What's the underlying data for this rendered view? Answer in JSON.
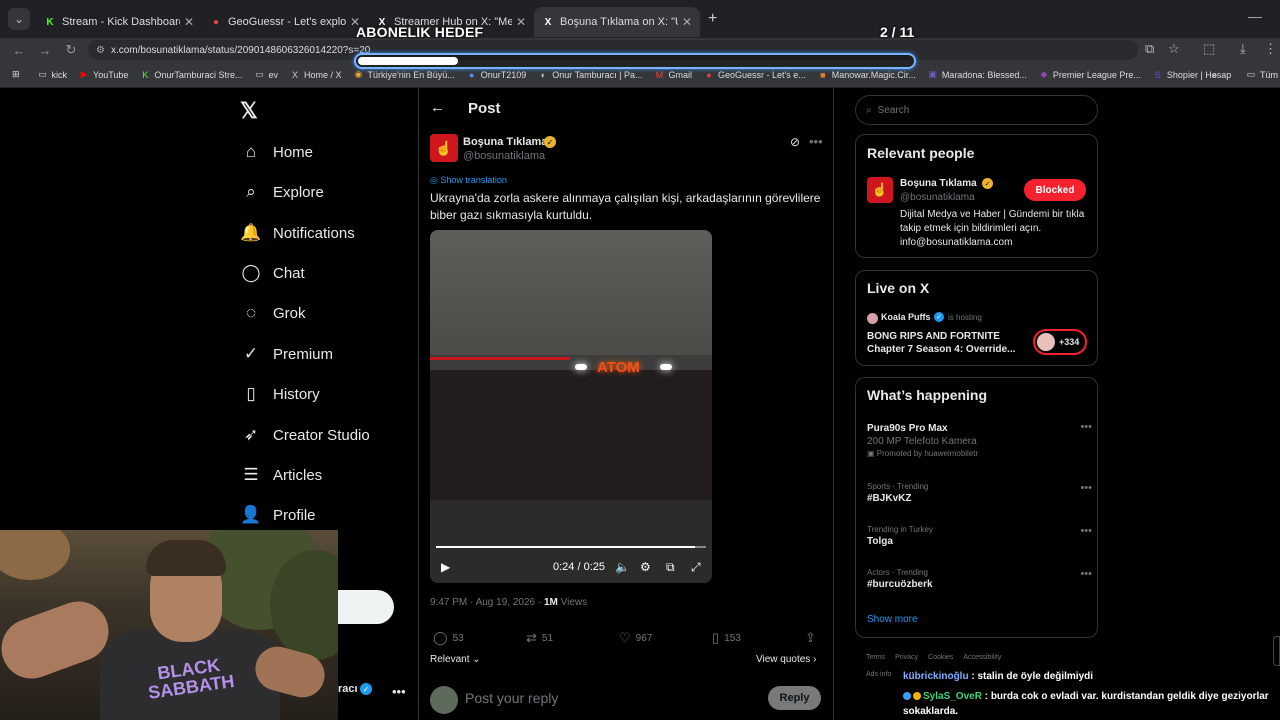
{
  "browser": {
    "tabs": [
      {
        "title": "Stream - Kick Dashboard",
        "fav": "K",
        "fav_color": "#53fc18"
      },
      {
        "title": "GeoGuessr - Let's explore the w",
        "fav": "●",
        "fav_color": "#e64141"
      },
      {
        "title": "Streamer Hub on X: \"Mercan E",
        "fav": "X",
        "fav_color": "#ffffff"
      },
      {
        "title": "Boşuna Tıklama on X: \"Ukrayna",
        "fav": "X",
        "fav_color": "#ffffff"
      }
    ],
    "url": "x.com/bosunatiklama/status/2090148606326014220?s=20",
    "bookmarks": [
      {
        "label": "kick",
        "icon": "folder-icon"
      },
      {
        "label": "YouTube",
        "icon": "youtube-icon"
      },
      {
        "label": "OnurTamburaci Stre...",
        "icon": "kick-icon"
      },
      {
        "label": "ev",
        "icon": "folder-icon"
      },
      {
        "label": "Home / X",
        "icon": "x-icon"
      },
      {
        "label": "Türkiye'nin En Büyü...",
        "icon": "globe-icon"
      },
      {
        "label": "OnurT2109",
        "icon": "person-icon"
      },
      {
        "label": "Onur Tamburacı | Pa...",
        "icon": "circle-icon"
      },
      {
        "label": "Gmail",
        "icon": "gmail-icon"
      },
      {
        "label": "GeoGuessr - Let's e...",
        "icon": "pin-icon"
      },
      {
        "label": "Manowar.Magic.Cir...",
        "icon": "box-icon"
      },
      {
        "label": "Maradona: Blessed...",
        "icon": "film-icon"
      },
      {
        "label": "Premier League Pre...",
        "icon": "ball-icon"
      },
      {
        "label": "Shopier | Hesap",
        "icon": "shop-icon"
      }
    ],
    "bookmarks_folder": "Tüm"
  },
  "overlay": {
    "goal_title": "ABONELIK HEDEF",
    "goal_count": "2 / 11",
    "goal_progress": 0.18
  },
  "sidebar": {
    "items": [
      {
        "label": "Home",
        "icon": "home-icon",
        "glyph": "⌂"
      },
      {
        "label": "Explore",
        "icon": "search-icon",
        "glyph": "⌕"
      },
      {
        "label": "Notifications",
        "icon": "bell-icon",
        "glyph": "🔔"
      },
      {
        "label": "Chat",
        "icon": "chat-icon",
        "glyph": "◯"
      },
      {
        "label": "Grok",
        "icon": "grok-icon",
        "glyph": "◌"
      },
      {
        "label": "Premium",
        "icon": "premium-icon",
        "glyph": "✓"
      },
      {
        "label": "History",
        "icon": "bookmark-icon",
        "glyph": "▯"
      },
      {
        "label": "Creator Studio",
        "icon": "rocket-icon",
        "glyph": "➶"
      },
      {
        "label": "Articles",
        "icon": "articles-icon",
        "glyph": "☰"
      },
      {
        "label": "Profile",
        "icon": "profile-icon",
        "glyph": "👤"
      }
    ],
    "account_partial": "racı"
  },
  "post": {
    "header_title": "Post",
    "author_name": "Boşuna Tıklama",
    "author_handle": "@bosunatiklama",
    "show_translation": "Show translation",
    "text": "Ukrayna'da zorla askere alınmaya çalışılan kişi, arkadaşlarının görevlilere biber gazı sıkmasıyla kurtuldu.",
    "video": {
      "sign": "ATOM",
      "time": "0:24 / 0:25",
      "progress": 0.96
    },
    "timestamp": "9:47 PM · Aug 19, 2026 · ",
    "views_count": "1M",
    "views_label": " Views",
    "stats": {
      "replies": "53",
      "reposts": "51",
      "likes": "967",
      "bookmarks": "153"
    },
    "relevant_label": "Relevant",
    "view_quotes": "View quotes",
    "reply_placeholder": "Post your reply",
    "reply_button": "Reply"
  },
  "right": {
    "search_placeholder": "Search",
    "relevant_people": {
      "title": "Relevant people",
      "name": "Boşuna Tıklama",
      "handle": "@bosunatiklama",
      "button": "Blocked",
      "bio": "Dijital Medya ve Haber | Gündemi bir tıkla takip etmek için bildirimleri açın. info@bosunatiklama.com"
    },
    "live": {
      "title": "Live on X",
      "host_name": "Koala Puffs",
      "host_label": "is hosting",
      "stream_title": "BONG RIPS AND FORTNITE Chapter 7 Season 4: Override...",
      "listeners": "+334"
    },
    "happening": {
      "title": "What’s happening",
      "items": [
        {
          "context": "",
          "name": "Pura90s Pro Max",
          "sub": "200 MP Telefoto Kamera",
          "promo": "Promoted by huaweimobiletr"
        },
        {
          "context": "Sports · Trending",
          "name": "#BJKvKZ",
          "sub": "",
          "promo": ""
        },
        {
          "context": "Trending in Turkey",
          "name": "Tolga",
          "sub": "",
          "promo": ""
        },
        {
          "context": "Actors · Trending",
          "name": "#burcuözberk",
          "sub": "",
          "promo": ""
        }
      ],
      "show_more": "Show more"
    },
    "footer": [
      "Terms",
      "Privacy",
      "Cookies",
      "Accessibility"
    ],
    "ads_info": "Ads info"
  },
  "chat": [
    {
      "user": "kübrickinoğlu",
      "message": " : stalin de öyle değilmiydi"
    },
    {
      "user": "SylaS_OveR",
      "message": " : burda cok o evladi var. kurdistandan geldik diye geziyorlar sokaklarda."
    }
  ],
  "webcam": {
    "shirt_text": "BLACK SABBATH"
  }
}
